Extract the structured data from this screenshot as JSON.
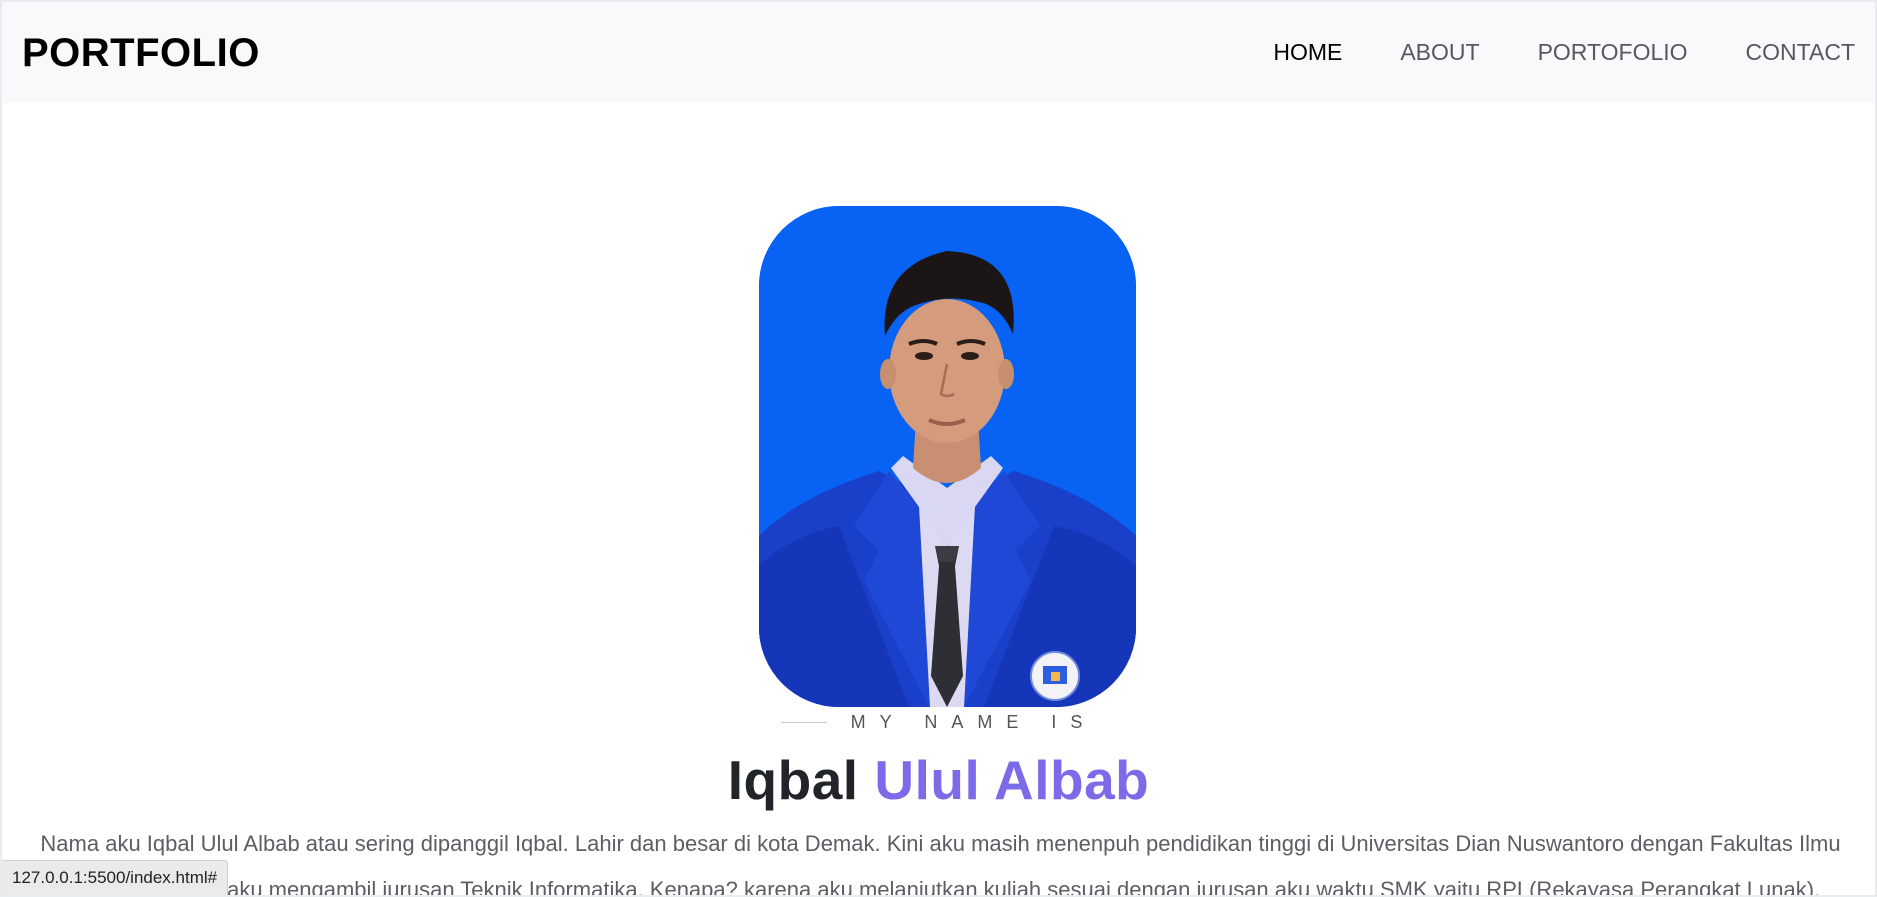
{
  "navbar": {
    "brand": "PORTFOLIO",
    "items": [
      {
        "label": "HOME",
        "active": true
      },
      {
        "label": "ABOUT",
        "active": false
      },
      {
        "label": "PORTOFOLIO",
        "active": false
      },
      {
        "label": "CONTACT",
        "active": false
      }
    ]
  },
  "hero": {
    "eyebrow": "MY NAME IS",
    "first_name": "Iqbal",
    "last_name": "Ulul Albab",
    "bio": "Nama aku Iqbal Ulul Albab atau sering dipanggil Iqbal. Lahir dan besar di kota Demak. Kini aku masih menenpuh pendidikan tinggi di Universitas Dian Nuswantoro dengan Fakultas Ilmu Komputer. Disini aku mengambil jurusan Teknik Informatika. Kenapa? karena aku melanjutkan kuliah sesuai dengan jurusan aku waktu SMK yaitu RPL(Rekayasa Perangkat Lunak)."
  },
  "status_bar": {
    "url": "127.0.0.1:5500/index.html#"
  },
  "colors": {
    "accent": "#7c6be8",
    "photo_background": "#0a63f3"
  }
}
